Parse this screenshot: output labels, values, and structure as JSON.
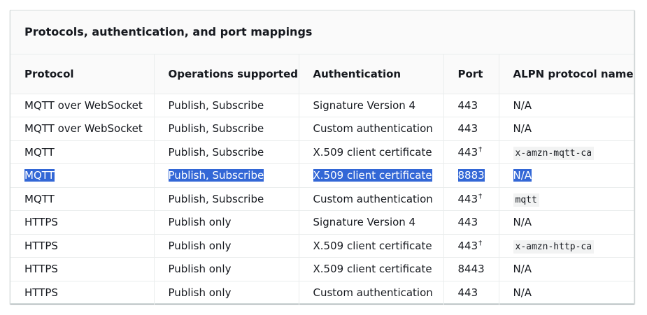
{
  "table": {
    "caption": "Protocols, authentication, and port mappings",
    "headers": [
      "Protocol",
      "Operations supported",
      "Authentication",
      "Port",
      "ALPN protocol name"
    ],
    "rows": [
      {
        "protocol": "MQTT over WebSocket",
        "operations": "Publish, Subscribe",
        "authentication": "Signature Version 4",
        "port": "443",
        "port_note": "",
        "alpn": "N/A",
        "alpn_is_code": false,
        "selected": false
      },
      {
        "protocol": "MQTT over WebSocket",
        "operations": "Publish, Subscribe",
        "authentication": "Custom authentication",
        "port": "443",
        "port_note": "",
        "alpn": "N/A",
        "alpn_is_code": false,
        "selected": false
      },
      {
        "protocol": "MQTT",
        "operations": "Publish, Subscribe",
        "authentication": "X.509 client certificate",
        "port": "443",
        "port_note": "†",
        "alpn": "x-amzn-mqtt-ca",
        "alpn_is_code": true,
        "selected": false
      },
      {
        "protocol": "MQTT",
        "operations": "Publish, Subscribe",
        "authentication": "X.509 client certificate",
        "port": "8883",
        "port_note": "",
        "alpn": "N/A",
        "alpn_is_code": false,
        "selected": true
      },
      {
        "protocol": "MQTT",
        "operations": "Publish, Subscribe",
        "authentication": "Custom authentication",
        "port": "443",
        "port_note": "†",
        "alpn": "mqtt",
        "alpn_is_code": true,
        "selected": false
      },
      {
        "protocol": "HTTPS",
        "operations": "Publish only",
        "authentication": "Signature Version 4",
        "port": "443",
        "port_note": "",
        "alpn": "N/A",
        "alpn_is_code": false,
        "selected": false
      },
      {
        "protocol": "HTTPS",
        "operations": "Publish only",
        "authentication": "X.509 client certificate",
        "port": "443",
        "port_note": "†",
        "alpn": "x-amzn-http-ca",
        "alpn_is_code": true,
        "selected": false
      },
      {
        "protocol": "HTTPS",
        "operations": "Publish only",
        "authentication": "X.509 client certificate",
        "port": "8443",
        "port_note": "",
        "alpn": "N/A",
        "alpn_is_code": false,
        "selected": false
      },
      {
        "protocol": "HTTPS",
        "operations": "Publish only",
        "authentication": "Custom authentication",
        "port": "443",
        "port_note": "",
        "alpn": "N/A",
        "alpn_is_code": false,
        "selected": false
      }
    ]
  },
  "colors": {
    "selection_background": "#3367d6",
    "selection_text": "#ffffff",
    "header_background": "#fafafa",
    "border": "#eaeded"
  }
}
